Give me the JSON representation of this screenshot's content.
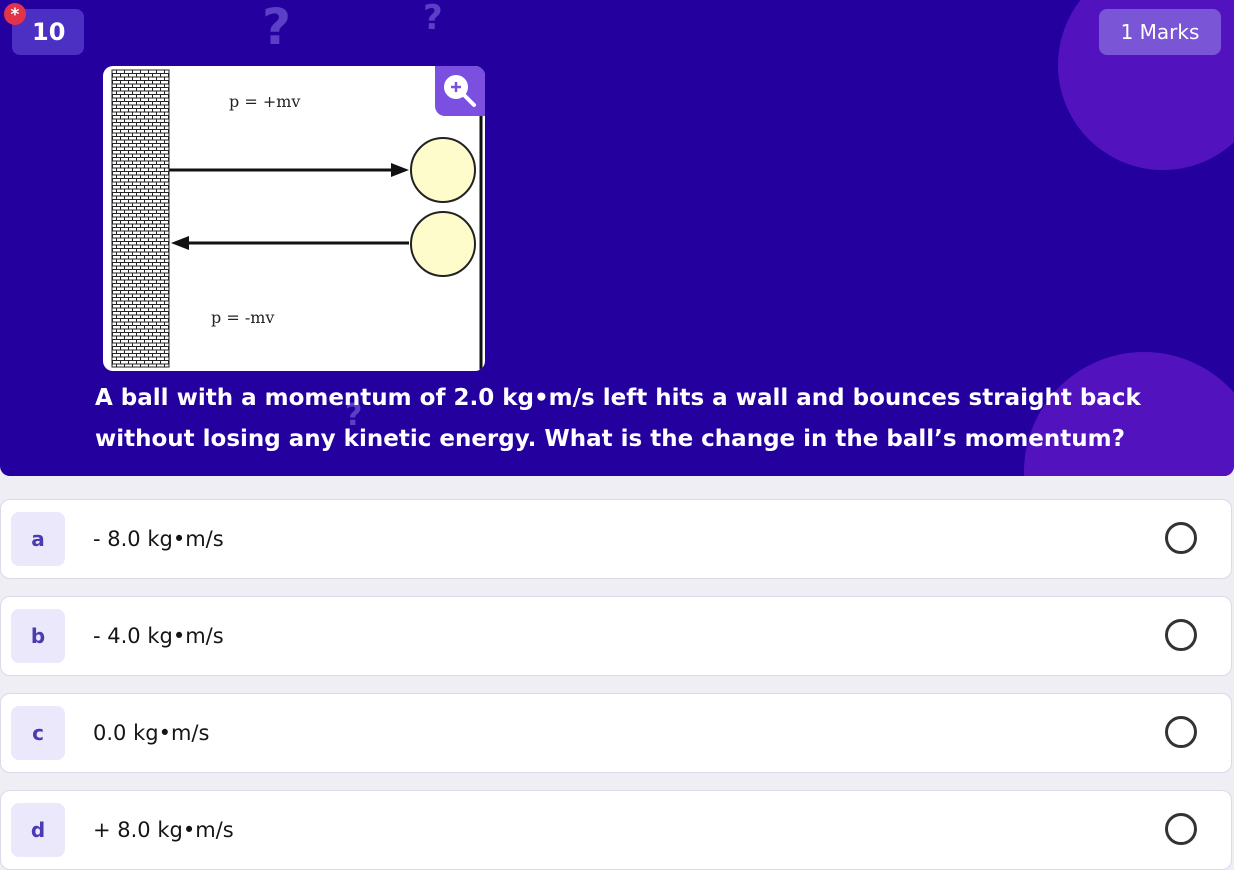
{
  "question": {
    "number": "10",
    "required_marker": "*",
    "marks": "1 Marks",
    "text": "A ball with a momentum of 2.0 kg•m/s left hits a wall and bounces straight back without losing any kinetic energy. What is the change in the ball’s momentum?",
    "decoration_glyph": "?"
  },
  "figure": {
    "top_label": "p = +mv",
    "bottom_label": "p = -mv"
  },
  "zoom": {
    "icon": "zoom-in-icon"
  },
  "options": [
    {
      "letter": "a",
      "text": "- 8.0 kg•m/s"
    },
    {
      "letter": "b",
      "text": "- 4.0 kg•m/s"
    },
    {
      "letter": "c",
      "text": "0.0 kg•m/s"
    },
    {
      "letter": "d",
      "text": "+ 8.0 kg•m/s"
    }
  ],
  "colors": {
    "header_bg": "#24009f",
    "badge_bg": "#4c2fc3",
    "marks_bg": "#7a55d6",
    "accent_purple": "#7b4fe0",
    "ball_fill": "#fffccc"
  }
}
